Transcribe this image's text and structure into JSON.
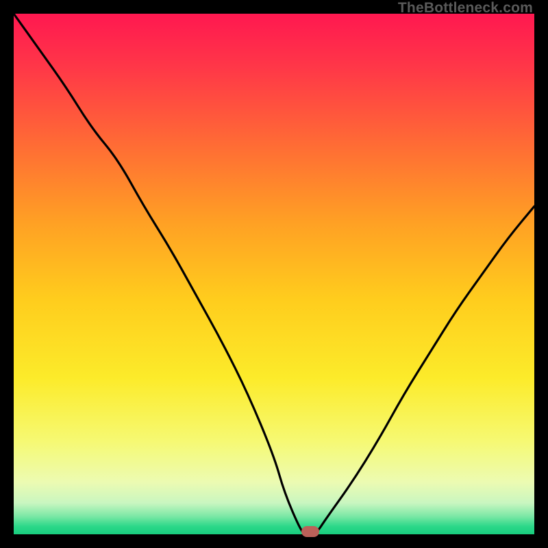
{
  "watermark": "TheBottleneck.com",
  "chart_data": {
    "type": "line",
    "title": "",
    "xlabel": "",
    "ylabel": "",
    "xlim": [
      0,
      100
    ],
    "ylim": [
      0,
      100
    ],
    "grid": false,
    "series": [
      {
        "name": "bottleneck-curve",
        "x": [
          0,
          5,
          10,
          15,
          20,
          25,
          30,
          35,
          40,
          45,
          50,
          52,
          55,
          56,
          58,
          60,
          65,
          70,
          75,
          80,
          85,
          90,
          95,
          100
        ],
        "values": [
          100,
          93,
          86,
          78,
          72,
          63,
          55,
          46,
          37,
          27,
          15,
          8,
          1,
          0,
          0,
          3,
          10,
          18,
          27,
          35,
          43,
          50,
          57,
          63
        ]
      }
    ],
    "marker": {
      "x": 57,
      "y": 0.5,
      "name": "optimal-point"
    },
    "background_gradient": {
      "stops": [
        {
          "pos": 0.0,
          "color": "#ff1850"
        },
        {
          "pos": 0.1,
          "color": "#ff3648"
        },
        {
          "pos": 0.25,
          "color": "#ff6b35"
        },
        {
          "pos": 0.4,
          "color": "#ffa024"
        },
        {
          "pos": 0.55,
          "color": "#ffcd1d"
        },
        {
          "pos": 0.7,
          "color": "#fceb2a"
        },
        {
          "pos": 0.82,
          "color": "#f6f972"
        },
        {
          "pos": 0.9,
          "color": "#ecfbb2"
        },
        {
          "pos": 0.94,
          "color": "#c9f6c0"
        },
        {
          "pos": 0.965,
          "color": "#7de8a6"
        },
        {
          "pos": 0.985,
          "color": "#2bd889"
        },
        {
          "pos": 1.0,
          "color": "#18cd7d"
        }
      ]
    }
  }
}
